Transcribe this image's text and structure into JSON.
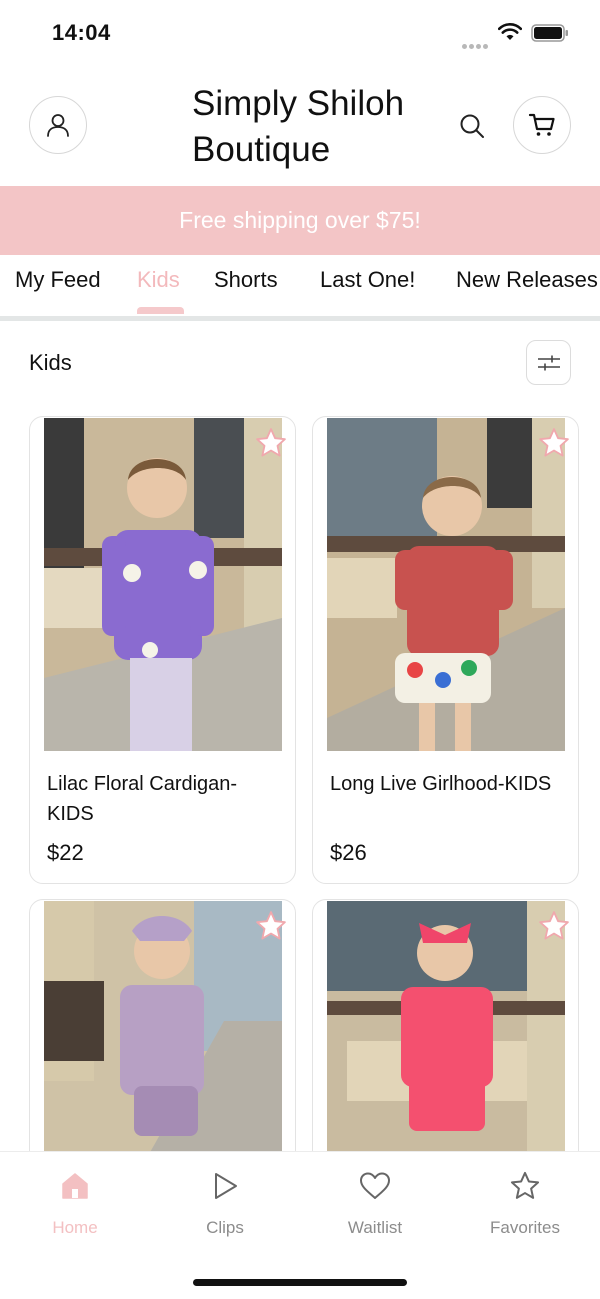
{
  "status_bar": {
    "time": "14:04"
  },
  "header": {
    "title": "Simply Shiloh Boutique",
    "account_icon": "person-icon",
    "search_icon": "search-icon",
    "cart_icon": "cart-icon"
  },
  "promo": {
    "text": "Free shipping over $75!"
  },
  "tabs": [
    {
      "label": "My Feed",
      "active": false
    },
    {
      "label": "Kids",
      "active": true
    },
    {
      "label": "Shorts",
      "active": false
    },
    {
      "label": "Last One!",
      "active": false
    },
    {
      "label": "New Releases",
      "active": false
    }
  ],
  "section": {
    "title": "Kids",
    "filter_icon": "sliders-icon"
  },
  "products": [
    {
      "name": "Lilac Floral Cardigan-KIDS",
      "price": "$22",
      "favorite_icon": "star-icon"
    },
    {
      "name": "Long Live Girlhood-KIDS",
      "price": "$26",
      "favorite_icon": "star-icon"
    },
    {
      "name": "",
      "price": "",
      "favorite_icon": "star-icon"
    },
    {
      "name": "",
      "price": "",
      "favorite_icon": "star-icon"
    }
  ],
  "bottom_nav": [
    {
      "label": "Home",
      "icon": "home-icon",
      "active": true
    },
    {
      "label": "Clips",
      "icon": "play-icon",
      "active": false
    },
    {
      "label": "Waitlist",
      "icon": "heart-icon",
      "active": false
    },
    {
      "label": "Favorites",
      "icon": "star-icon",
      "active": false
    }
  ],
  "colors": {
    "accent_pink": "#f3c5c6",
    "active_tab": "#f3b9bc",
    "text": "#111111",
    "muted": "#8c8c8c"
  }
}
